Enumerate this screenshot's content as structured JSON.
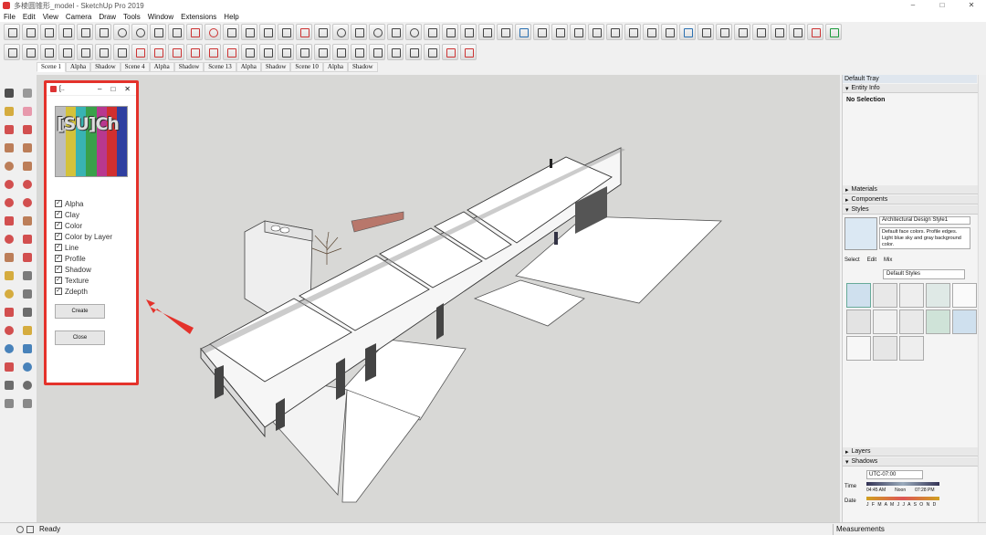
{
  "window": {
    "title": "多棱圆锥形_model - SketchUp Pro 2019",
    "minimize": "–",
    "maximize": "□",
    "close": "✕"
  },
  "menu": [
    "File",
    "Edit",
    "View",
    "Camera",
    "Draw",
    "Tools",
    "Window",
    "Extensions",
    "Help"
  ],
  "scenes": [
    "Scene 1",
    "Alpha",
    "Shadow",
    "Scene 4",
    "Alpha",
    "Shadow",
    "Scene 13",
    "Alpha",
    "Shadow",
    "Scene 10",
    "Alpha",
    "Shadow"
  ],
  "dialog": {
    "title": "[..",
    "logo_text": "[SU]Ch",
    "options": [
      "Alpha",
      "Clay",
      "Color",
      "Color by Layer",
      "Line",
      "Profile",
      "Shadow",
      "Texture",
      "Zdepth"
    ],
    "create_label": "Create",
    "close_label": "Close"
  },
  "tray": {
    "title": "Default Tray",
    "entity_info": "Entity Info",
    "no_selection": "No Selection",
    "materials": "Materials",
    "components": "Components",
    "styles": "Styles",
    "style_name": "Architectural Design Style1",
    "style_desc": "Default face colors. Profile edges. Light blue sky and gray background color.",
    "tabs": [
      "Select",
      "Edit",
      "Mix"
    ],
    "style_collection": "Default Styles",
    "layers": "Layers",
    "shadows": "Shadows",
    "timezone": "UTC-07:00",
    "time_label": "Time",
    "date_label": "Date",
    "time_start": "04:45 AM",
    "time_noon": "Noon",
    "time_end": "07:28 PM",
    "months": "J F M A M J J A S O N D"
  },
  "status": {
    "text": "Ready",
    "measurements": "Measurements"
  }
}
